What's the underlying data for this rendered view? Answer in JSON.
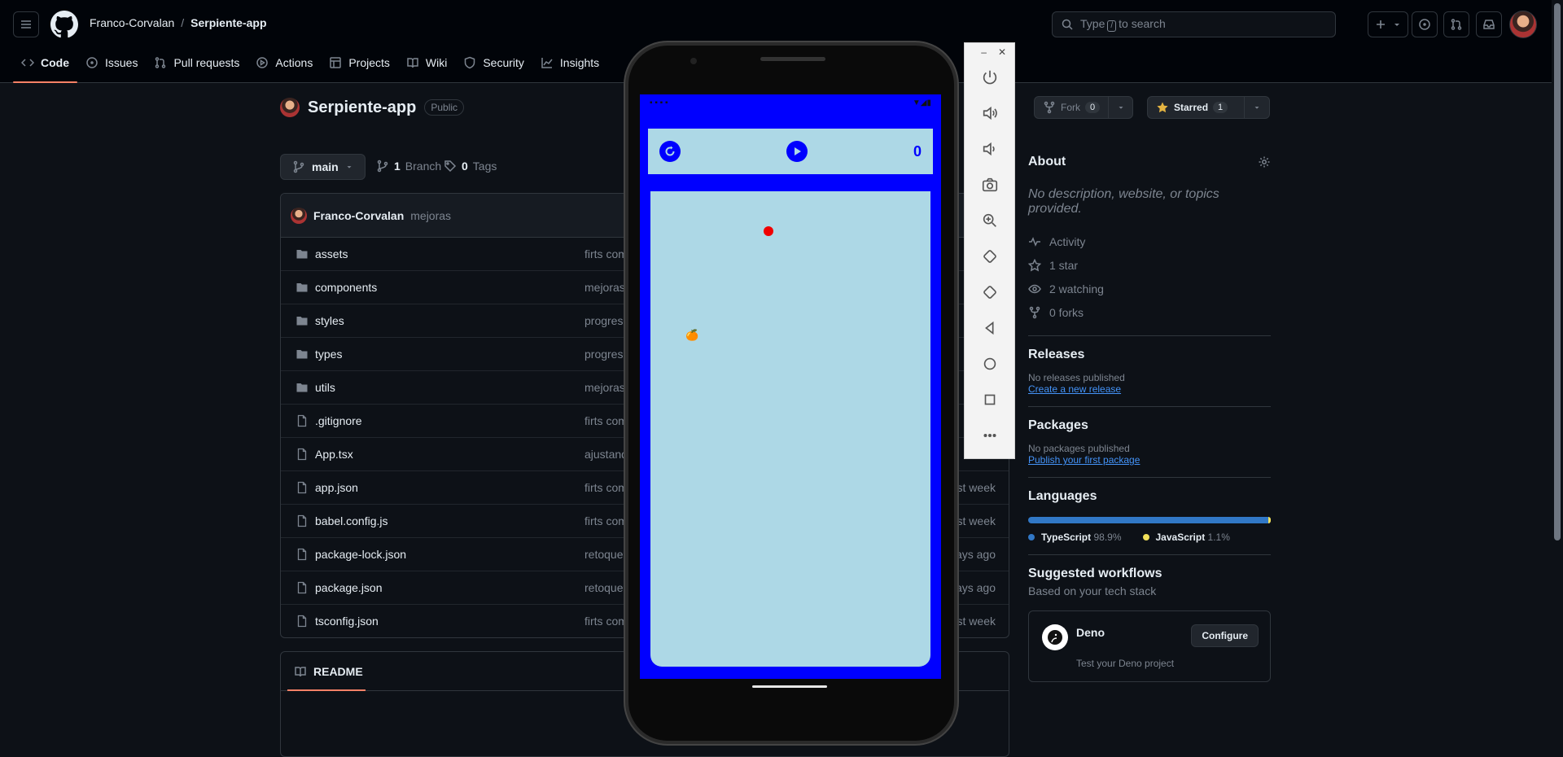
{
  "header": {
    "owner": "Franco-Corvalan",
    "separator": "/",
    "repo": "Serpiente-app",
    "search_text": "Type / to search",
    "search_pre": "Type",
    "search_key": "/",
    "search_post": "to search"
  },
  "nav": [
    {
      "label": "Code",
      "icon": "code-icon"
    },
    {
      "label": "Issues",
      "icon": "issue-icon"
    },
    {
      "label": "Pull requests",
      "icon": "pull-request-icon"
    },
    {
      "label": "Actions",
      "icon": "play-icon"
    },
    {
      "label": "Projects",
      "icon": "table-icon"
    },
    {
      "label": "Wiki",
      "icon": "book-icon"
    },
    {
      "label": "Security",
      "icon": "shield-icon"
    },
    {
      "label": "Insights",
      "icon": "graph-icon"
    }
  ],
  "repo": {
    "name": "Serpiente-app",
    "visibility": "Public",
    "fork_label": "Fork",
    "fork_count": "0",
    "star_label": "Starred",
    "star_count": "1",
    "branch": "main",
    "branches_count": "1",
    "branches_label": "Branch",
    "tags_count": "0",
    "tags_label": "Tags"
  },
  "commit": {
    "author": "Franco-Corvalan",
    "message": "mejoras"
  },
  "files": [
    {
      "name": "assets",
      "type": "dir",
      "commit": "firts com",
      "time": ""
    },
    {
      "name": "components",
      "type": "dir",
      "commit": "mejoras",
      "time": ""
    },
    {
      "name": "styles",
      "type": "dir",
      "commit": "progres",
      "time": ""
    },
    {
      "name": "types",
      "type": "dir",
      "commit": "progres",
      "time": ""
    },
    {
      "name": "utils",
      "type": "dir",
      "commit": "mejoras",
      "time": ""
    },
    {
      "name": ".gitignore",
      "type": "file",
      "commit": "firts com",
      "time": ""
    },
    {
      "name": "App.tsx",
      "type": "file",
      "commit": "ajustand",
      "time": ""
    },
    {
      "name": "app.json",
      "type": "file",
      "commit": "firts com",
      "time": "st week"
    },
    {
      "name": "babel.config.js",
      "type": "file",
      "commit": "firts com",
      "time": "st week"
    },
    {
      "name": "package-lock.json",
      "type": "file",
      "commit": "retoque",
      "time": "ays ago"
    },
    {
      "name": "package.json",
      "type": "file",
      "commit": "retoque",
      "time": "ays ago"
    },
    {
      "name": "tsconfig.json",
      "type": "file",
      "commit": "firts com",
      "time": "st week"
    }
  ],
  "readme": {
    "label": "README"
  },
  "about": {
    "title": "About",
    "description": "No description, website, or topics provided.",
    "stats": [
      {
        "icon": "pulse-icon",
        "label": "Activity"
      },
      {
        "icon": "star-icon",
        "label": "1 star"
      },
      {
        "icon": "eye-icon",
        "label": "2 watching"
      },
      {
        "icon": "fork-icon",
        "label": "0 forks"
      }
    ]
  },
  "releases": {
    "title": "Releases",
    "text": "No releases published",
    "link": "Create a new release"
  },
  "packages": {
    "title": "Packages",
    "text": "No packages published",
    "link": "Publish your first package"
  },
  "languages": {
    "title": "Languages",
    "items": [
      {
        "name": "TypeScript",
        "percent": "98.9%",
        "color": "#3178c6"
      },
      {
        "name": "JavaScript",
        "percent": "1.1%",
        "color": "#f1e05a"
      }
    ],
    "typescript_fraction": 0.989
  },
  "workflows": {
    "title": "Suggested workflows",
    "subtitle": "Based on your tech stack",
    "items": [
      {
        "name": "Deno",
        "description": "Test your Deno project",
        "button": "Configure"
      }
    ]
  },
  "game": {
    "score": "0",
    "colors": {
      "background": "#0000ff",
      "board": "#add8e6",
      "snake": "#f00000"
    },
    "fruit": "🍊"
  },
  "emulator": {
    "buttons": [
      "power-icon",
      "volume-up-icon",
      "volume-down-icon",
      "camera-icon",
      "zoom-icon",
      "rotate-left-icon",
      "rotate-right-icon",
      "back-icon",
      "home-icon",
      "overview-icon",
      "more-icon"
    ]
  }
}
